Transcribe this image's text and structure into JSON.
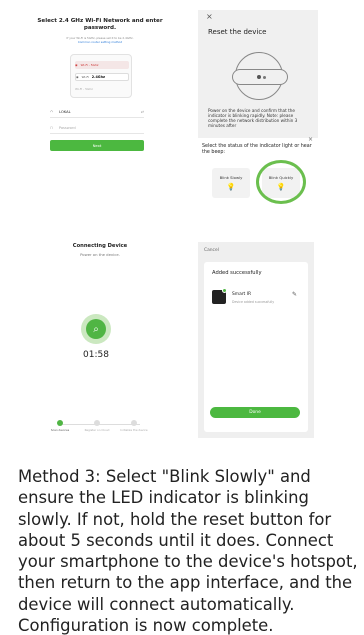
{
  "wifi_screen": {
    "title": "Select 2.4 GHz Wi-Fi Network and enter password.",
    "note": "If your Wi-Fi is 5GHz, please set it to be 2.4GHz.",
    "note_link": "Common router setting method",
    "router_row1": "Wi-Fi - 5Ghz",
    "router_row2_label": "Wi-Fi",
    "router_row2_value": "2.4Ghz",
    "router_row3": "Wi-Fi - 5Ghz",
    "ssid_value": "LOKAL",
    "ssid_suffix": "⇄",
    "password_placeholder": "Password",
    "next_label": "Next"
  },
  "reset_screen": {
    "close": "×",
    "title": "Reset the device",
    "description": "Power on the device and confirm that the indicator is blinking rapidly. Note: please complete the network distribution within 3 minutes after",
    "sheet_title": "Select the status of the indicator light or hear the beep:",
    "sheet_close": "×",
    "option_slow": "Blink Slowly",
    "option_quick": "Blink Quickly"
  },
  "connecting_screen": {
    "title": "Connecting Device",
    "subtitle": "Power on the device.",
    "timer": "01:58",
    "steps": [
      {
        "label": "Scan devices"
      },
      {
        "label": "Register on Cloud"
      },
      {
        "label": "Initialize the device"
      }
    ]
  },
  "added_screen": {
    "cancel": "Cancel",
    "title": "Added successfully",
    "device_name": "Smart IR",
    "device_status": "Device added successfully",
    "done_label": "Done"
  },
  "caption": "Method 3: Select \"Blink Slowly\" and\nensure the LED indicator is blinking\nslowly. If not, hold the reset button for\nabout 5 seconds until it does. Connect\nyour smartphone to the device's hotspot,\nthen return to the app interface, and the\ndevice will connect automatically.\nConfiguration is now complete."
}
